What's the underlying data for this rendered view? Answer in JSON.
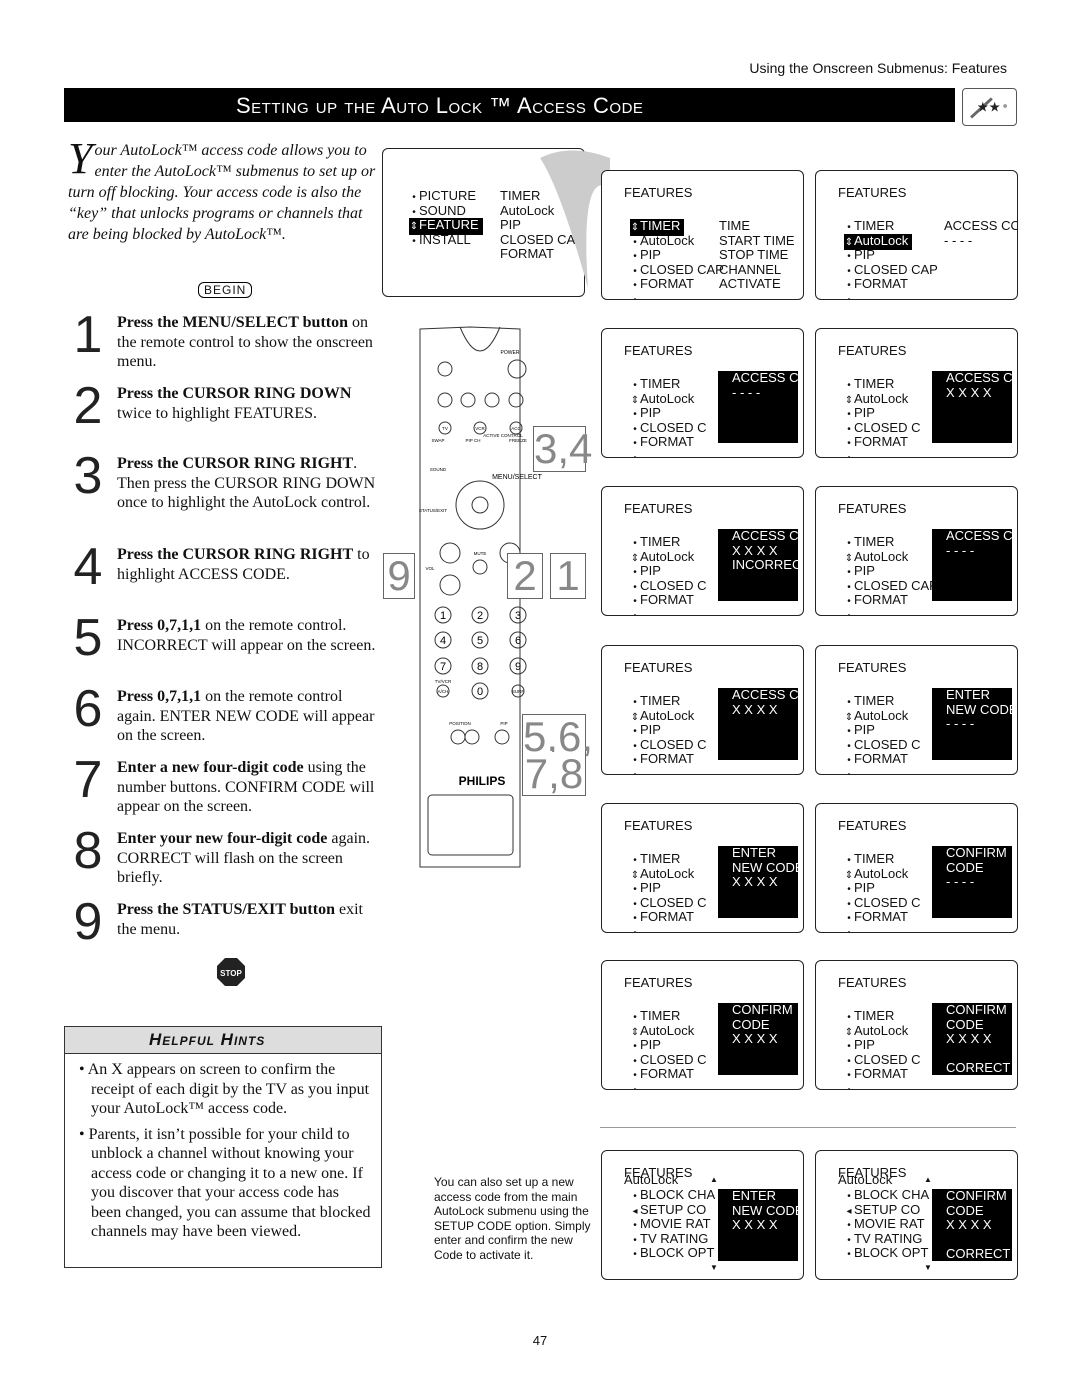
{
  "running_head": "Using the Onscreen Submenus: Features",
  "title": "Setting up the Auto Lock ™ Access Code",
  "intro": {
    "drop": "Y",
    "text": "our AutoLock™ access code allows you to enter the AutoLock™ submenus to set up or turn off blocking. Your access code is also the “key” that unlocks programs or channels that are being blocked by AutoLock™."
  },
  "begin_label": "BEGIN",
  "steps": [
    {
      "n": "1",
      "bold": "Press the MENU/SELECT button",
      "rest": " on the remote control to show the onscreen menu."
    },
    {
      "n": "2",
      "bold": "Press the CURSOR RING DOWN",
      "rest": " twice to highlight FEATURES."
    },
    {
      "n": "3",
      "bold": "Press the CURSOR RING RIGHT",
      "rest": ". Then press the CURSOR RING DOWN once to highlight the AutoLock control."
    },
    {
      "n": "4",
      "bold": "Press the CURSOR RING RIGHT",
      "rest": " to highlight ACCESS CODE."
    },
    {
      "n": "5",
      "bold": "Press 0,7,1,1",
      "rest": " on the remote control. INCORRECT will appear on the screen."
    },
    {
      "n": "6",
      "bold": "Press 0,7,1,1",
      "rest": " on the remote control again. ENTER NEW CODE will appear on the screen."
    },
    {
      "n": "7",
      "bold": "Enter a new four-digit code",
      "rest": " using the number buttons. CONFIRM CODE will appear on the screen."
    },
    {
      "n": "8",
      "bold": "Enter your new four-digit code",
      "rest": " again. CORRECT will flash on the screen briefly."
    },
    {
      "n": "9",
      "bold": "Press the STATUS/EXIT button",
      "rest": " exit the menu."
    }
  ],
  "stop_label": "STOP",
  "hints": {
    "title": "Helpful Hints",
    "items": [
      "An X appears on screen to confirm the receipt of each digit by the TV as you input your AutoLock™ access code.",
      "Parents, it isn’t possible for your child to unblock a channel without knowing your access code or changing it to a new one. If you discover that your access code has been changed, you can assume that blocked channels may have been viewed."
    ]
  },
  "main_menu": {
    "items": [
      "PICTURE",
      "SOUND",
      "FEATURE",
      "INSTALL"
    ],
    "selected": 2,
    "right": [
      "TIMER",
      "AutoLock",
      "PIP",
      "CLOSED CAP",
      "FORMAT"
    ]
  },
  "screens": [
    {
      "title": "FEATURES",
      "items": [
        "TIMER",
        "AutoLock",
        "PIP",
        "CLOSED CAP",
        "FORMAT",
        ""
      ],
      "sel": 0,
      "right": [
        "TIME",
        "START TIME",
        "STOP TIME",
        "CHANNEL",
        "ACTIVATE"
      ]
    },
    {
      "title": "FEATURES",
      "items": [
        "TIMER",
        "AutoLock",
        "PIP",
        "CLOSED CAP",
        "FORMAT",
        ""
      ],
      "sel": 1,
      "right": [
        "ACCESS CODE",
        "- - - -"
      ]
    },
    {
      "title": "FEATURES",
      "items": [
        "TIMER",
        "AutoLock",
        "PIP",
        "CLOSED C",
        "FORMAT",
        ""
      ],
      "cur": 1,
      "box": [
        "ACCESS CODE",
        "- - - -"
      ]
    },
    {
      "title": "FEATURES",
      "items": [
        "TIMER",
        "AutoLock",
        "PIP",
        "CLOSED C",
        "FORMAT",
        ""
      ],
      "cur": 1,
      "box": [
        "ACCESS CODE",
        "X X X X"
      ]
    },
    {
      "title": "FEATURES",
      "items": [
        "TIMER",
        "AutoLock",
        "PIP",
        "CLOSED C",
        "FORMAT",
        ""
      ],
      "cur": 1,
      "box": [
        "ACCESS CODE",
        "X X X X",
        "INCORRECT"
      ]
    },
    {
      "title": "FEATURES",
      "items": [
        "TIMER",
        "AutoLock",
        "PIP",
        "CLOSED CAP",
        "FORMAT",
        ""
      ],
      "cur": 1,
      "box": [
        "ACCESS CODE",
        "- - - -"
      ]
    },
    {
      "title": "FEATURES",
      "items": [
        "TIMER",
        "AutoLock",
        "PIP",
        "CLOSED C",
        "FORMAT",
        ""
      ],
      "cur": 1,
      "box": [
        "ACCESS CODE",
        "X X X X"
      ]
    },
    {
      "title": "FEATURES",
      "items": [
        "TIMER",
        "AutoLock",
        "PIP",
        "CLOSED C",
        "FORMAT",
        ""
      ],
      "cur": 1,
      "box": [
        "ENTER",
        "NEW CODE",
        "- - - -"
      ]
    },
    {
      "title": "FEATURES",
      "items": [
        "TIMER",
        "AutoLock",
        "PIP",
        "CLOSED C",
        "FORMAT",
        ""
      ],
      "cur": 1,
      "box": [
        "ENTER",
        "NEW CODE",
        "X X X X"
      ]
    },
    {
      "title": "FEATURES",
      "items": [
        "TIMER",
        "AutoLock",
        "PIP",
        "CLOSED C",
        "FORMAT",
        ""
      ],
      "cur": 1,
      "box": [
        "CONFIRM",
        "CODE",
        "- - - -"
      ]
    },
    {
      "title": "FEATURES",
      "items": [
        "TIMER",
        "AutoLock",
        "PIP",
        "CLOSED C",
        "FORMAT",
        ""
      ],
      "cur": 1,
      "box": [
        "CONFIRM",
        "CODE",
        "X X X X"
      ]
    },
    {
      "title": "FEATURES",
      "items": [
        "TIMER",
        "AutoLock",
        "PIP",
        "CLOSED C",
        "FORMAT",
        ""
      ],
      "cur": 1,
      "box": [
        "CONFIRM",
        "CODE",
        "X X X X",
        "",
        "CORRECT"
      ]
    },
    {
      "title": "FEATURES",
      "sub": "AutoLock",
      "items": [
        "BLOCK CHA",
        "SETUP CO",
        "MOVIE RAT",
        "TV RATING",
        "BLOCK OPT"
      ],
      "cur": 1,
      "box": [
        "ENTER",
        "NEW CODE",
        "X X X X"
      ]
    },
    {
      "title": "FEATURES",
      "sub": "AutoLock",
      "items": [
        "BLOCK CHA",
        "SETUP CO",
        "MOVIE RAT",
        "TV RATING",
        "BLOCK OPT"
      ],
      "cur": 1,
      "box": [
        "CONFIRM",
        "CODE",
        "X X X X",
        "",
        "CORRECT"
      ]
    }
  ],
  "side_note": "You can also set up a new access code from the main AutoLock submenu using the SETUP CODE option. Simply enter and confirm the new Code to activate it.",
  "callouts": [
    "3,4",
    "9",
    "2",
    "1",
    "5,6,",
    "7,8"
  ],
  "remote": {
    "brand": "PHILIPS",
    "labels": [
      "POWER",
      "TV",
      "VCR",
      "ACC",
      "SWAP",
      "PIP CH",
      "ACTIVE CONTROL",
      "FREEZE",
      "SOUND",
      "STATUS/EXIT",
      "MENU/SELECT",
      "MUTE",
      "VOL",
      "TV/VCR",
      "A/CH",
      "SURF",
      "POSITION",
      "PIP"
    ],
    "digits": [
      "1",
      "2",
      "3",
      "4",
      "5",
      "6",
      "7",
      "8",
      "9",
      "0"
    ]
  },
  "page_number": "47"
}
